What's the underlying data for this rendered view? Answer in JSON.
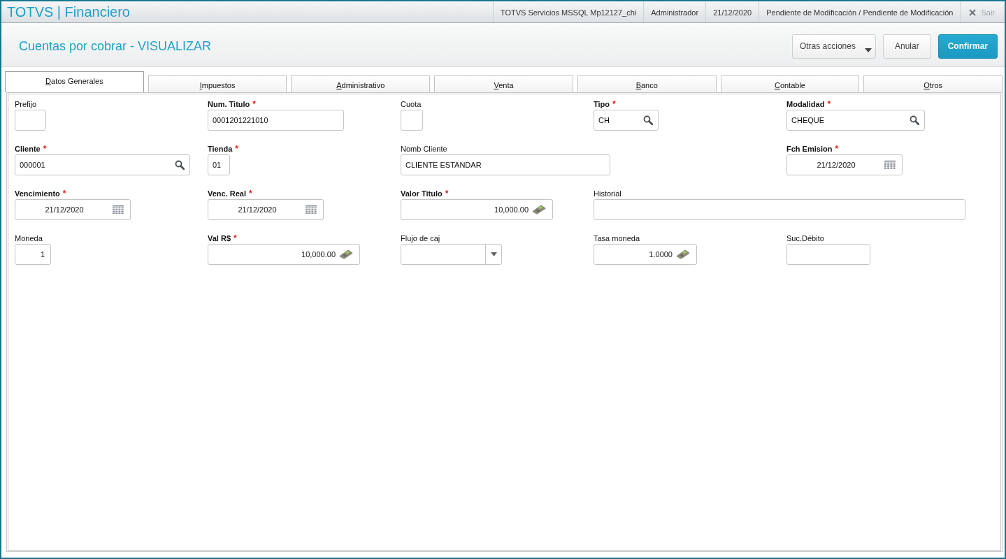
{
  "header": {
    "brand": "TOTVS | Financiero",
    "info": [
      "TOTVS Servicios MSSQL Mp12127_chi",
      "Administrador",
      "21/12/2020",
      "Pendiente de Modificación / Pendiente de Modificación"
    ],
    "exit": {
      "label": "Sair",
      "disabled": true
    }
  },
  "page": {
    "title": "Cuentas por cobrar - VISUALIZAR",
    "actions": [
      {
        "label": "Otras acciones",
        "kind": "menu"
      },
      {
        "label": "Anular",
        "kind": "secondary"
      },
      {
        "label": "Confirmar",
        "kind": "primary"
      }
    ]
  },
  "tabs": [
    {
      "label": "Datos Generales",
      "selected": true
    },
    {
      "label": "Impuestos",
      "selected": false
    },
    {
      "label": "Administrativo",
      "selected": false
    },
    {
      "label": "Venta",
      "selected": false
    },
    {
      "label": "Banco",
      "selected": false
    },
    {
      "label": "Contable",
      "selected": false
    },
    {
      "label": "Otros",
      "selected": false
    }
  ],
  "form": {
    "rows": [
      [
        {
          "label": "Prefijo",
          "kind": "text"
        },
        {
          "label": "Num. Titulo",
          "required_mark": "*",
          "kind": "text",
          "value": "0001201221010"
        },
        {
          "label": "Cuota",
          "kind": "text"
        },
        {
          "label": "Tipo",
          "required_mark": "*",
          "kind": "lookup",
          "value": "CH"
        },
        {
          "label": "Modalidad",
          "required_mark": "*",
          "kind": "lookup",
          "value": "CHEQUE"
        }
      ],
      [
        {
          "label": "Cliente",
          "required_mark": "*",
          "kind": "lookup",
          "value": "000001"
        },
        {
          "label": "Tienda",
          "required_mark": "*",
          "kind": "text",
          "value": "01"
        },
        {
          "label": "Nomb Cliente",
          "kind": "text",
          "value": "CLIENTE ESTANDAR"
        },
        "",
        {
          "label": "Fch Emision",
          "required_mark": "*",
          "kind": "date",
          "value": "21/12/2020"
        }
      ],
      [
        {
          "label": "Vencimiento",
          "required_mark": "*",
          "kind": "date",
          "value": "21/12/2020"
        },
        {
          "label": "Venc. Real",
          "required_mark": "*",
          "kind": "date",
          "value": "21/12/2020"
        },
        {
          "label": "Valor Titulo",
          "required_mark": "*",
          "kind": "currency",
          "value": "10,000.00"
        },
        {
          "label": "Historial",
          "kind": "text"
        }
      ],
      [
        {
          "label": "Moneda",
          "kind": "number",
          "value": "1"
        },
        {
          "label": "Val R$",
          "required_mark": "*",
          "kind": "currency",
          "value": "10,000.00"
        },
        {
          "label": "Flujo de caj",
          "kind": "select"
        },
        {
          "label": "Tasa moneda",
          "kind": "currency",
          "value": "1.0000"
        },
        {
          "label": "Suc.Débito",
          "kind": "text"
        }
      ]
    ]
  }
}
